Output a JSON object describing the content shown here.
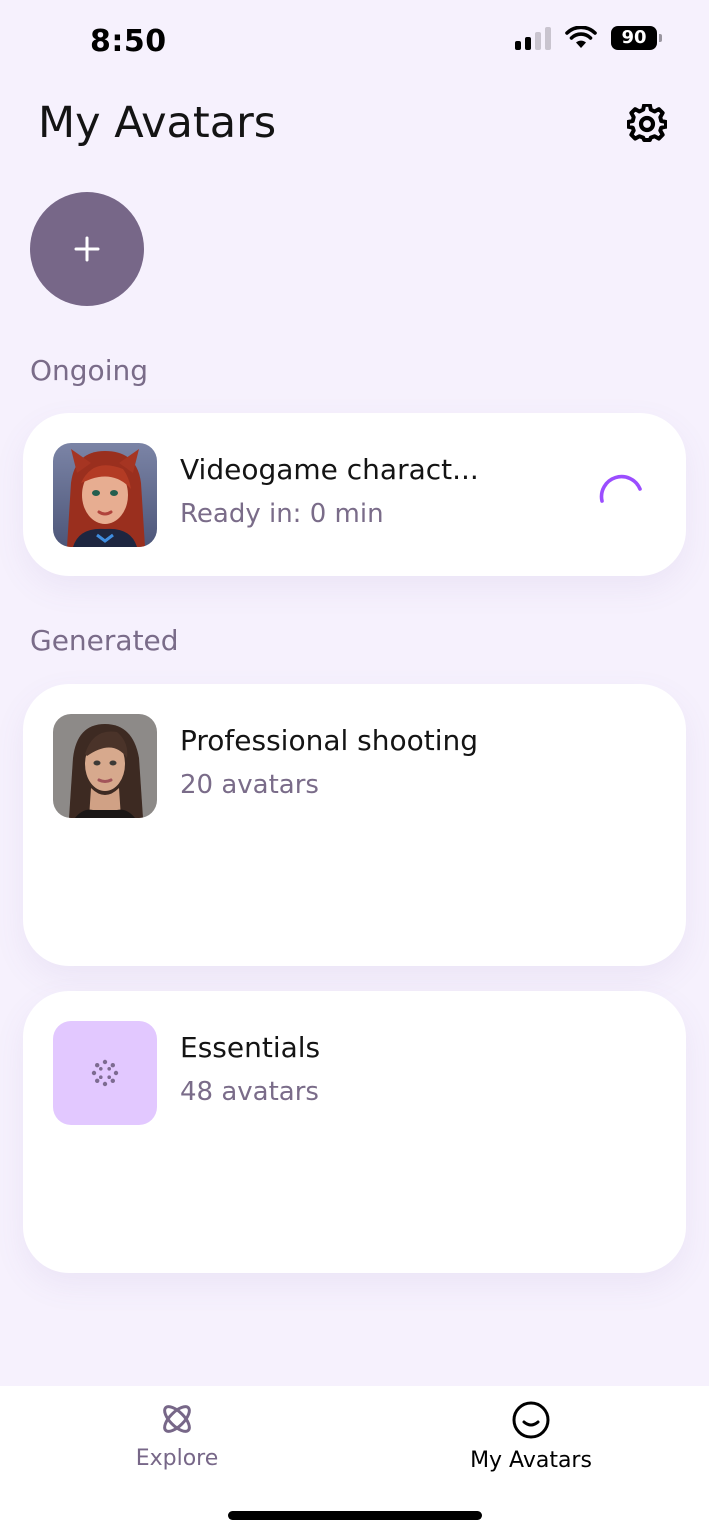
{
  "status_bar": {
    "time": "8:50",
    "battery": "90",
    "icons": [
      "signal-icon",
      "wifi-icon",
      "battery-icon"
    ]
  },
  "header": {
    "title": "My Avatars",
    "settings_icon": "gear-icon"
  },
  "add_button": {
    "icon": "plus-icon"
  },
  "ongoing": {
    "label": "Ongoing",
    "items": [
      {
        "title": "Videogame charact...",
        "subtitle": "Ready in: 0 min",
        "thumbnail": "videogame-character-portrait",
        "status_icon": "loading-spinner-icon"
      }
    ]
  },
  "generated": {
    "label": "Generated",
    "items": [
      {
        "title": "Professional shooting",
        "subtitle": "20 avatars",
        "thumbnail": "professional-portrait"
      },
      {
        "title": "Essentials",
        "subtitle": "48 avatars",
        "thumbnail": "loading-dots-icon"
      }
    ]
  },
  "bottom_nav": {
    "items": [
      {
        "label": "Explore",
        "icon": "atom-icon",
        "active": false
      },
      {
        "label": "My Avatars",
        "icon": "smiley-icon",
        "active": true
      }
    ]
  },
  "colors": {
    "background": "#f6f1fd",
    "accent": "#9b4dff",
    "muted_text": "#7a6c89",
    "add_button": "#776788",
    "essentials_thumb": "#e2c8ff"
  }
}
